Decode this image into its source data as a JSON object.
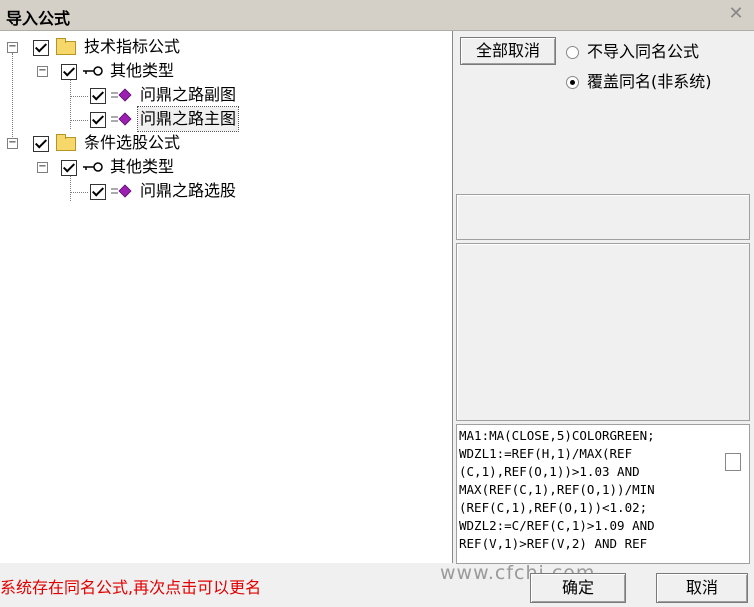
{
  "window": {
    "title": "导入公式",
    "close_icon": "close-icon"
  },
  "tree": {
    "nodes": [
      {
        "label": "技术指标公式",
        "icon": "folder-icon"
      },
      {
        "label": "其他类型",
        "icon": "key-icon"
      },
      {
        "label": "问鼎之路副图",
        "icon": "formula-gem-icon"
      },
      {
        "label": "问鼎之路主图",
        "icon": "formula-gem-icon",
        "selected": true
      },
      {
        "label": "条件选股公式",
        "icon": "folder-icon"
      },
      {
        "label": "其他类型",
        "icon": "key-icon"
      },
      {
        "label": "问鼎之路选股",
        "icon": "formula-gem-icon"
      }
    ]
  },
  "options": {
    "cancel_all": "全部取消",
    "radio_no_import": "不导入同名公式",
    "radio_overwrite": "覆盖同名(非系统)",
    "selected": "radio_overwrite"
  },
  "code": {
    "text": "MA1:MA(CLOSE,5)COLORGREEN;\nWDZL1:=REF(H,1)/MAX(REF\n(C,1),REF(O,1))>1.03 AND\nMAX(REF(C,1),REF(O,1))/MIN\n(REF(C,1),REF(O,1))<1.02;\nWDZL2:=C/REF(C,1)>1.09 AND\nREF(V,1)>REF(V,2) AND REF"
  },
  "footer": {
    "status": "系统存在同名公式,再次点击可以更名",
    "watermark": "www.cfchi.com",
    "ok": "确定",
    "cancel": "取消"
  },
  "colors": {
    "status": "#e00000",
    "gem": "#9b1fb0"
  }
}
